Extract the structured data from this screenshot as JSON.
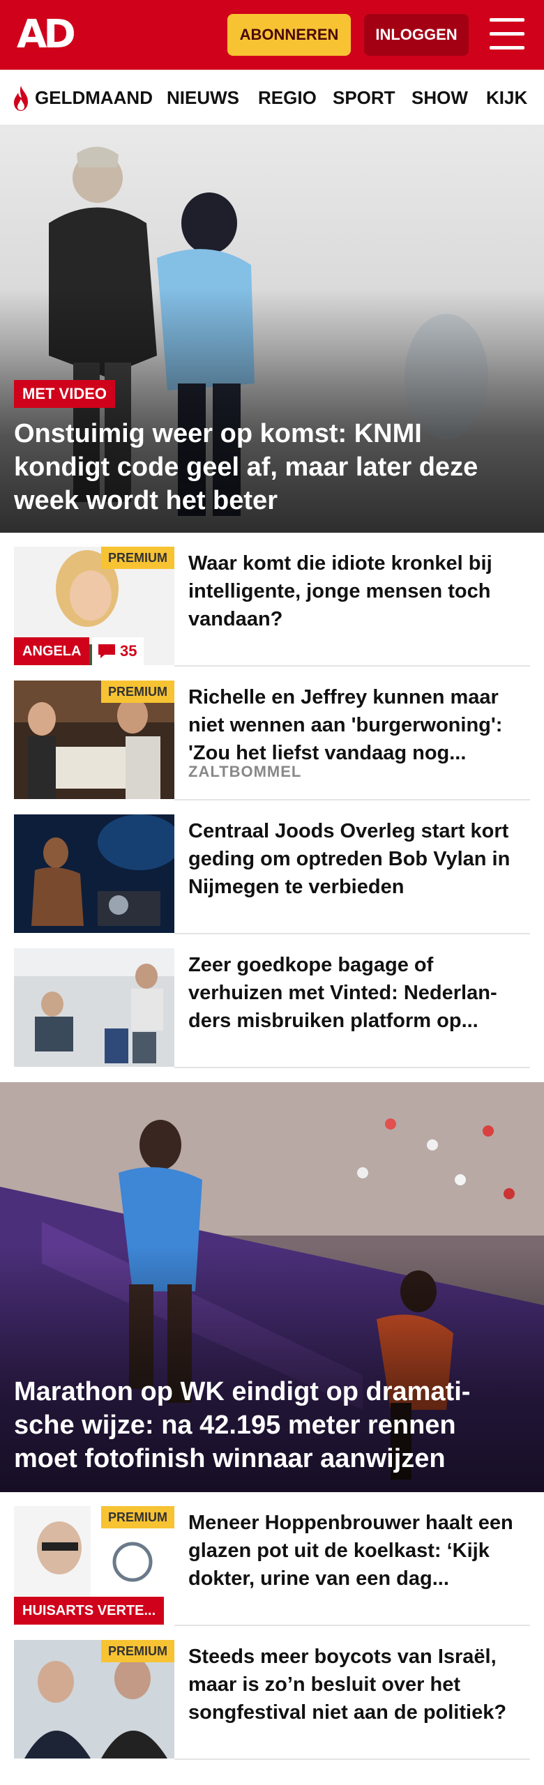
{
  "header": {
    "logo": "AD",
    "subscribe_label": "ABONNEREN",
    "login_label": "INLOGGEN"
  },
  "nav": {
    "items": [
      "GELDMAAND",
      "NIEUWS",
      "REGIO",
      "SPORT",
      "SHOW",
      "KIJK"
    ]
  },
  "hero1": {
    "tag": "MET VIDEO",
    "title": "Onstuimig weer op komst: KNMI kondigt code geel af, maar later deze week wordt het beter"
  },
  "articles": [
    {
      "premium": "PREMIUM",
      "author": "ANGELA",
      "comments": "35",
      "headline": "Waar komt die idiote kronkel bij intelligente, jonge mensen toch vandaan?"
    },
    {
      "premium": "PREMIUM",
      "headline": "Richelle en Jeffrey kunnen maar niet wennen aan 'burgerwoning': 'Zou het liefst vandaag nog...",
      "location": "ZALTBOMMEL"
    },
    {
      "headline": "Centraal Joods Overleg start kort geding om optreden Bob Vylan in Nijmegen te verbieden"
    },
    {
      "headline": "Zeer goedkope bagage of verhuizen met Vinted: Nederlan-ders misbruiken platform op..."
    }
  ],
  "hero2": {
    "title": "Marathon op WK eindigt op dramati-sche wijze: na 42.195 meter rennen moet fotofinish winnaar aanwijzen"
  },
  "articles2": [
    {
      "premium": "PREMIUM",
      "author": "HUISARTS VERTE...",
      "headline": "Meneer Hoppenbrouwer haalt een glazen pot uit de koelkast: ‘Kijk dokter, urine van een dag..."
    },
    {
      "premium": "PREMIUM",
      "headline": "Steeds meer boycots van Israël, maar is zo’n besluit over het songfestival niet aan de politiek?"
    }
  ],
  "colors": {
    "brand_red": "#d0021b",
    "premium_yellow": "#f7c332",
    "login_dark_red": "#a30014"
  }
}
